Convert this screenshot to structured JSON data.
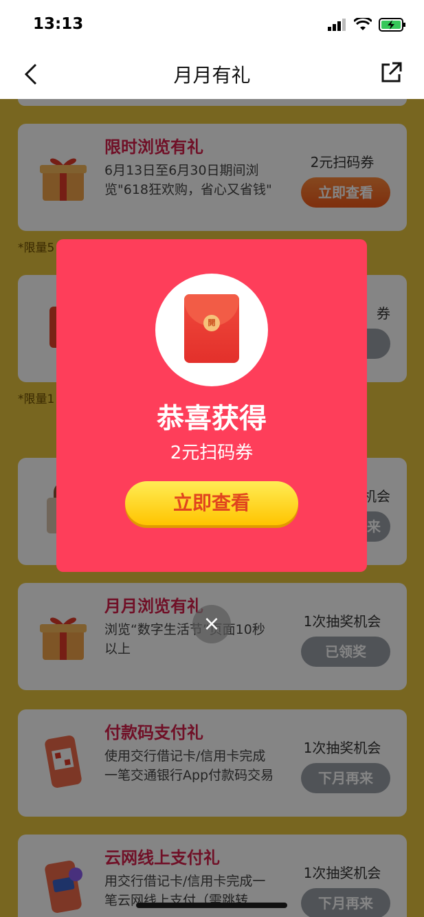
{
  "status": {
    "time": "13:13"
  },
  "nav": {
    "title": "月月有礼"
  },
  "cards": [
    {
      "title": "限时浏览有礼",
      "desc": "6月13日至6月30日期间浏览\"618狂欢购，省心又省钱\"",
      "reward": "2元扫码券",
      "button": "立即查看",
      "button_style": "orange"
    },
    {
      "title": "",
      "desc": "",
      "reward": "券",
      "button": "",
      "button_style": "gray"
    },
    {
      "title": "",
      "desc": "",
      "reward": "机会",
      "button": "来",
      "button_style": "gray"
    },
    {
      "title": "月月浏览有礼",
      "desc": "浏览“数字生活节”页面10秒以上",
      "reward": "1次抽奖机会",
      "button": "已领奖",
      "button_style": "gray"
    },
    {
      "title": "付款码支付礼",
      "desc": "使用交行借记卡/信用卡完成一笔交通银行App付款码交易",
      "reward": "1次抽奖机会",
      "button": "下月再来",
      "button_style": "gray"
    },
    {
      "title": "云网线上支付礼",
      "desc": "用交行借记卡/信用卡完成一笔云网线上支付（需跳转",
      "reward": "1次抽奖机会",
      "button": "下月再来",
      "button_style": "gray"
    }
  ],
  "notes": [
    "*限量5",
    "*限量1"
  ],
  "modal": {
    "seal": "開",
    "title": "恭喜获得",
    "subtitle": "2元扫码券",
    "button": "立即查看"
  },
  "close_icon": "×",
  "colors": {
    "modal_bg": "#fe3e5a",
    "page_bg": "#e6c43f",
    "accent": "#d6204c"
  }
}
